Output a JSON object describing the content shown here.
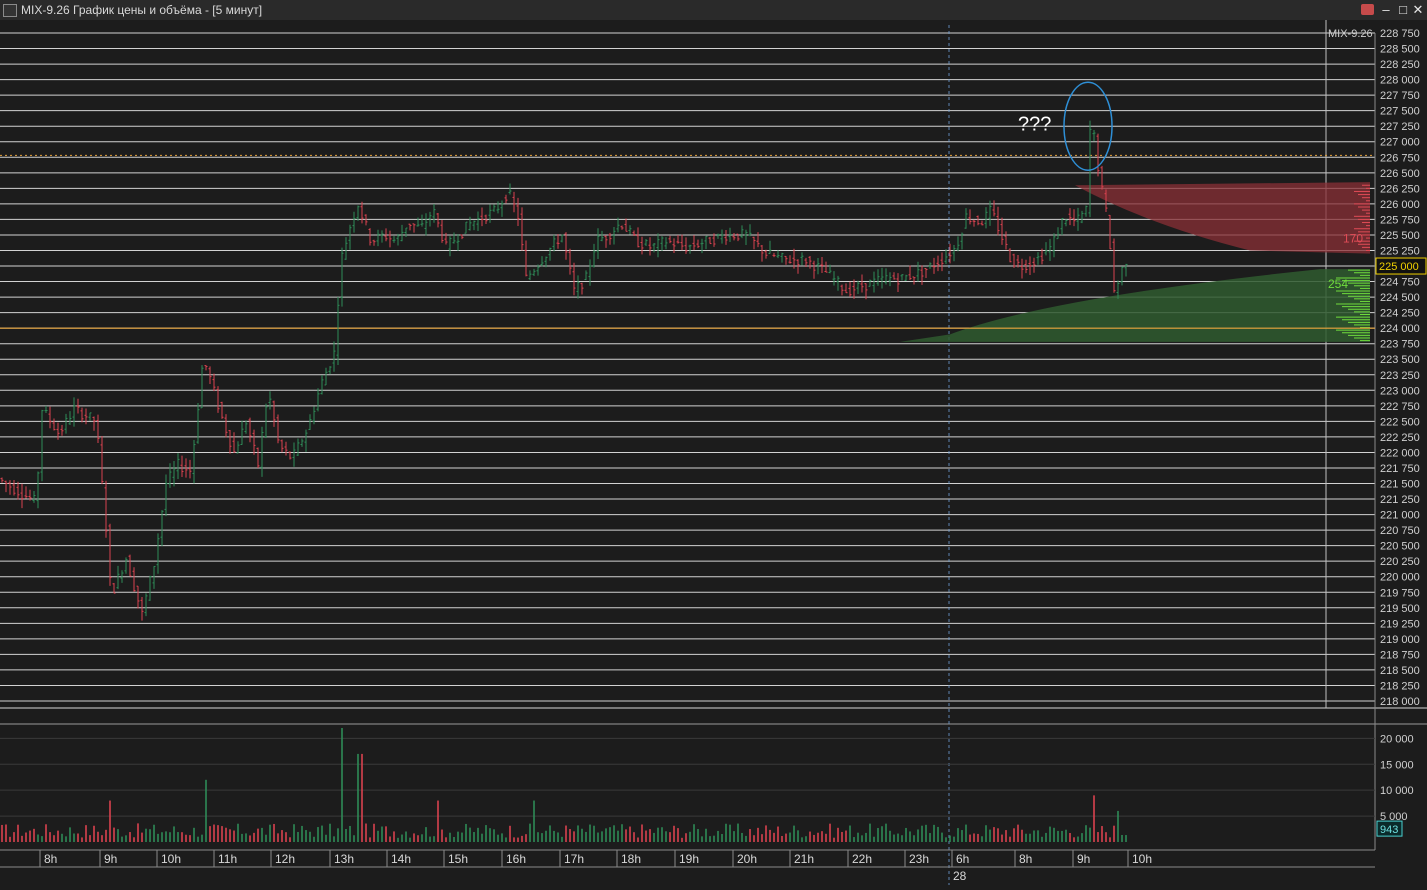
{
  "window": {
    "title": "MIX-9.26 График цены и объёма - [5 минут]",
    "btn_min": "–",
    "btn_max": "□",
    "btn_close": "✕",
    "app_icon": "chart-app-icon",
    "pin_icon": "pin-icon"
  },
  "colors": {
    "bg": "#1c1c1c",
    "up": "#2e8b57",
    "down": "#d9424f",
    "level": "#e8a33a",
    "current_price_bg": "#f0d000"
  },
  "chart_data": [
    {
      "type": "candlestick",
      "instrument": "MIX-9.26",
      "timeframe": "5 минут",
      "ylim": [
        218000,
        228750
      ],
      "y_ticks": [
        "218 000",
        "218 250",
        "218 500",
        "218 750",
        "219 000",
        "219 250",
        "219 500",
        "219 750",
        "220 000",
        "220 250",
        "220 500",
        "220 750",
        "221 000",
        "221 250",
        "221 500",
        "221 750",
        "222 000",
        "222 250",
        "222 500",
        "222 750",
        "223 000",
        "223 250",
        "223 500",
        "223 750",
        "224 000",
        "224 250",
        "224 500",
        "224 750",
        "225 000",
        "225 250",
        "225 500",
        "225 750",
        "226 000",
        "226 250",
        "226 500",
        "226 750",
        "227 000",
        "227 250",
        "227 500",
        "227 750",
        "228 000",
        "228 250",
        "228 500",
        "228 750"
      ],
      "x_labels": [
        "8h",
        "9h",
        "10h",
        "11h",
        "12h",
        "13h",
        "14h",
        "15h",
        "16h",
        "17h",
        "18h",
        "19h",
        "20h",
        "21h",
        "22h",
        "23h",
        "6h",
        "8h",
        "9h",
        "10h"
      ],
      "day_label": "28",
      "current_price": "225 000",
      "level_price": 224000,
      "dotted_level_price": 226780,
      "annotation": "???",
      "profile_labels": {
        "upper": "170",
        "lower": "254"
      },
      "corner_label": "MIX-9.26",
      "path": [
        [
          0,
          221600
        ],
        [
          40,
          221200
        ],
        [
          46,
          222700
        ],
        [
          63,
          222300
        ],
        [
          78,
          222700
        ],
        [
          100,
          222500
        ],
        [
          110,
          220800
        ],
        [
          115,
          219700
        ],
        [
          130,
          220300
        ],
        [
          146,
          219400
        ],
        [
          158,
          220200
        ],
        [
          170,
          221500
        ],
        [
          182,
          221800
        ],
        [
          195,
          221700
        ],
        [
          207,
          223500
        ],
        [
          212,
          223300
        ],
        [
          225,
          222600
        ],
        [
          238,
          222000
        ],
        [
          250,
          222500
        ],
        [
          262,
          221800
        ],
        [
          272,
          223000
        ],
        [
          283,
          222100
        ],
        [
          296,
          221900
        ],
        [
          312,
          222400
        ],
        [
          325,
          223100
        ],
        [
          338,
          223600
        ],
        [
          345,
          225100
        ],
        [
          355,
          225700
        ],
        [
          362,
          226000
        ],
        [
          375,
          225400
        ],
        [
          388,
          225500
        ],
        [
          400,
          225400
        ],
        [
          412,
          225700
        ],
        [
          425,
          225600
        ],
        [
          437,
          225900
        ],
        [
          450,
          225300
        ],
        [
          463,
          225500
        ],
        [
          475,
          225700
        ],
        [
          488,
          225800
        ],
        [
          500,
          225900
        ],
        [
          512,
          226200
        ],
        [
          522,
          225800
        ],
        [
          530,
          224800
        ],
        [
          545,
          225100
        ],
        [
          555,
          225300
        ],
        [
          566,
          225500
        ],
        [
          578,
          224600
        ],
        [
          590,
          224800
        ],
        [
          600,
          225400
        ],
        [
          612,
          225500
        ],
        [
          625,
          225700
        ],
        [
          640,
          225400
        ],
        [
          655,
          225300
        ],
        [
          670,
          225400
        ],
        [
          690,
          225300
        ],
        [
          710,
          225400
        ],
        [
          730,
          225500
        ],
        [
          750,
          225500
        ],
        [
          770,
          225200
        ],
        [
          790,
          225100
        ],
        [
          810,
          225100
        ],
        [
          830,
          224900
        ],
        [
          850,
          224600
        ],
        [
          870,
          224700
        ],
        [
          890,
          224800
        ],
        [
          905,
          224800
        ],
        [
          925,
          224900
        ],
        [
          945,
          225100
        ],
        [
          960,
          225300
        ],
        [
          970,
          225800
        ],
        [
          985,
          225700
        ],
        [
          995,
          225900
        ],
        [
          1005,
          225500
        ],
        [
          1015,
          225100
        ],
        [
          1025,
          225000
        ],
        [
          1040,
          225100
        ],
        [
          1055,
          225300
        ],
        [
          1068,
          225800
        ],
        [
          1080,
          225700
        ],
        [
          1090,
          225900
        ],
        [
          1095,
          227500
        ],
        [
          1100,
          226800
        ],
        [
          1106,
          226200
        ],
        [
          1112,
          225700
        ],
        [
          1118,
          224600
        ],
        [
          1124,
          224800
        ],
        [
          1128,
          225100
        ]
      ],
      "volume": {
        "ylim": [
          0,
          22000
        ],
        "y_ticks": [
          "5 000",
          "10 000",
          "15 000",
          "20 000"
        ],
        "last": "943",
        "spikes": [
          [
            110,
            8000
          ],
          [
            205,
            12000
          ],
          [
            341,
            22000
          ],
          [
            360,
            17000
          ],
          [
            437,
            8000
          ],
          [
            535,
            8000
          ],
          [
            1093,
            9000
          ],
          [
            1118,
            6000
          ]
        ]
      }
    }
  ]
}
